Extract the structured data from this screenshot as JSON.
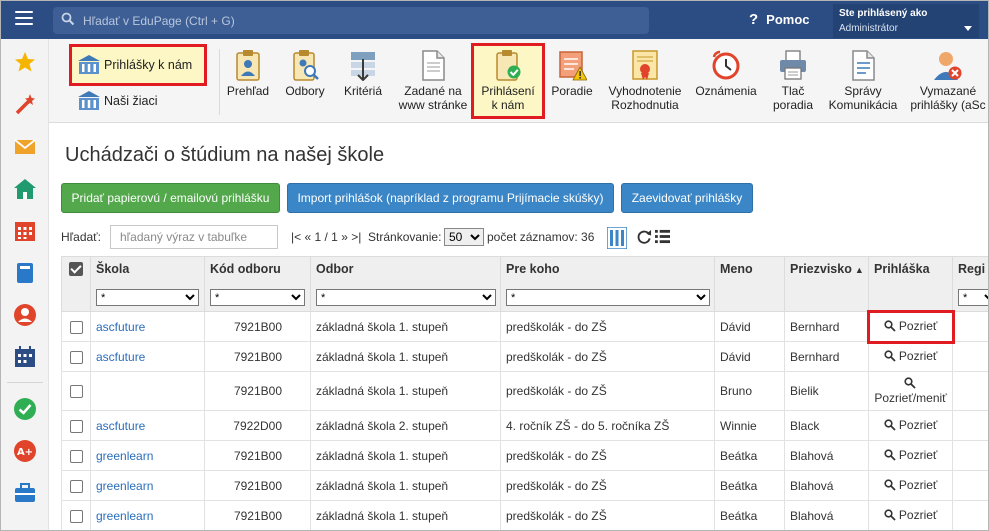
{
  "topbar": {
    "search_placeholder": "Hľadať v EduPage (Ctrl + G)",
    "help_label": "Pomoc",
    "user_line1": "Ste prihlásený ako",
    "user_line2": "Administrátor"
  },
  "sidebar": {
    "icons": [
      "star-icon",
      "wand-icon",
      "mail-icon",
      "home-icon",
      "calendar-icon",
      "book-icon",
      "person-badge-icon",
      "timetable-icon",
      "check-badge-icon",
      "grade-badge-icon",
      "briefcase-icon"
    ]
  },
  "toolbar": {
    "left_items": [
      {
        "label": "Prihlášky k nám",
        "icon": "school-building-icon"
      },
      {
        "label": "Naši žiaci",
        "icon": "school-building-icon"
      }
    ],
    "items": [
      {
        "line1": "Prehľad",
        "line2": "",
        "icon": "clipboard-person-icon"
      },
      {
        "line1": "Odbory",
        "line2": "",
        "icon": "clipboard-search-icon"
      },
      {
        "line1": "Kritériá",
        "line2": "",
        "icon": "filter-list-icon"
      },
      {
        "line1": "Zadané na",
        "line2": "www stránke",
        "icon": "document-icon"
      },
      {
        "line1": "Prihlásení",
        "line2": "k nám",
        "icon": "clipboard-check-icon"
      },
      {
        "line1": "Poradie",
        "line2": "",
        "icon": "ranking-warning-icon"
      },
      {
        "line1": "Vyhodnotenie",
        "line2": "Rozhodnutia",
        "icon": "certificate-icon"
      },
      {
        "line1": "Oznámenia",
        "line2": "",
        "icon": "alarm-clock-icon"
      },
      {
        "line1": "Tlač",
        "line2": "poradia",
        "icon": "printer-icon"
      },
      {
        "line1": "Správy",
        "line2": "Komunikácia",
        "icon": "message-document-icon"
      },
      {
        "line1": "Vymazané",
        "line2": "prihlášky (aSc",
        "icon": "person-delete-icon"
      }
    ]
  },
  "page": {
    "title": "Uchádzači o štúdium na našej škole"
  },
  "actions": {
    "add_paper": "Pridať papierovú / emailovú prihlášku",
    "import": "Import prihlášok (napríklad z programu Prijímacie skúšky)",
    "register": "Zaevidovať prihlášky"
  },
  "filter": {
    "label": "Hľadať:",
    "placeholder": "hľadaný výraz v tabuľke",
    "pager_first": "|<",
    "pager_prev": "«",
    "pager_pos": "1 / 1",
    "pager_next": "»",
    "pager_last": ">|",
    "paging_label": "Stránkovanie:",
    "page_size": "50",
    "count_label": "počet záznamov: 36"
  },
  "table": {
    "columns": [
      "Škola",
      "Kód odboru",
      "Odbor",
      "Pre koho",
      "Meno",
      "Priezvisko",
      "Prihláška",
      "Regi"
    ],
    "filter_value": "*",
    "rows": [
      {
        "school": "ascfuture",
        "code": "7921B00",
        "field": "základná škola 1. stupeň",
        "for": "predškolák - do ZŠ",
        "name": "Dávid",
        "surname": "Bernhard",
        "action": "Pozrieť"
      },
      {
        "school": "ascfuture",
        "code": "7921B00",
        "field": "základná škola 1. stupeň",
        "for": "predškolák - do ZŠ",
        "name": "Dávid",
        "surname": "Bernhard",
        "action": "Pozrieť"
      },
      {
        "school": "",
        "code": "7921B00",
        "field": "základná škola 1. stupeň",
        "for": "predškolák - do ZŠ",
        "name": "Bruno",
        "surname": "Bielik",
        "action": "Pozrieť/meniť"
      },
      {
        "school": "ascfuture",
        "code": "7922D00",
        "field": "základná škola 2. stupeň",
        "for": "4. ročník ZŠ - do 5. ročníka ZŠ",
        "name": "Winnie",
        "surname": "Black",
        "action": "Pozrieť"
      },
      {
        "school": "greenlearn",
        "code": "7921B00",
        "field": "základná škola 1. stupeň",
        "for": "predškolák - do ZŠ",
        "name": "Beátka",
        "surname": "Blahová",
        "action": "Pozrieť"
      },
      {
        "school": "greenlearn",
        "code": "7921B00",
        "field": "základná škola 1. stupeň",
        "for": "predškolák - do ZŠ",
        "name": "Beátka",
        "surname": "Blahová",
        "action": "Pozrieť"
      },
      {
        "school": "greenlearn",
        "code": "7921B00",
        "field": "základná škola 1. stupeň",
        "for": "predškolák - do ZŠ",
        "name": "Beátka",
        "surname": "Blahová",
        "action": "Pozrieť"
      }
    ]
  },
  "colors": {
    "topbar": "#2c4d84",
    "highlight": "#e01b22",
    "green_button": "#52a84b",
    "blue_button": "#3b86c6",
    "link": "#2a6ebb"
  }
}
